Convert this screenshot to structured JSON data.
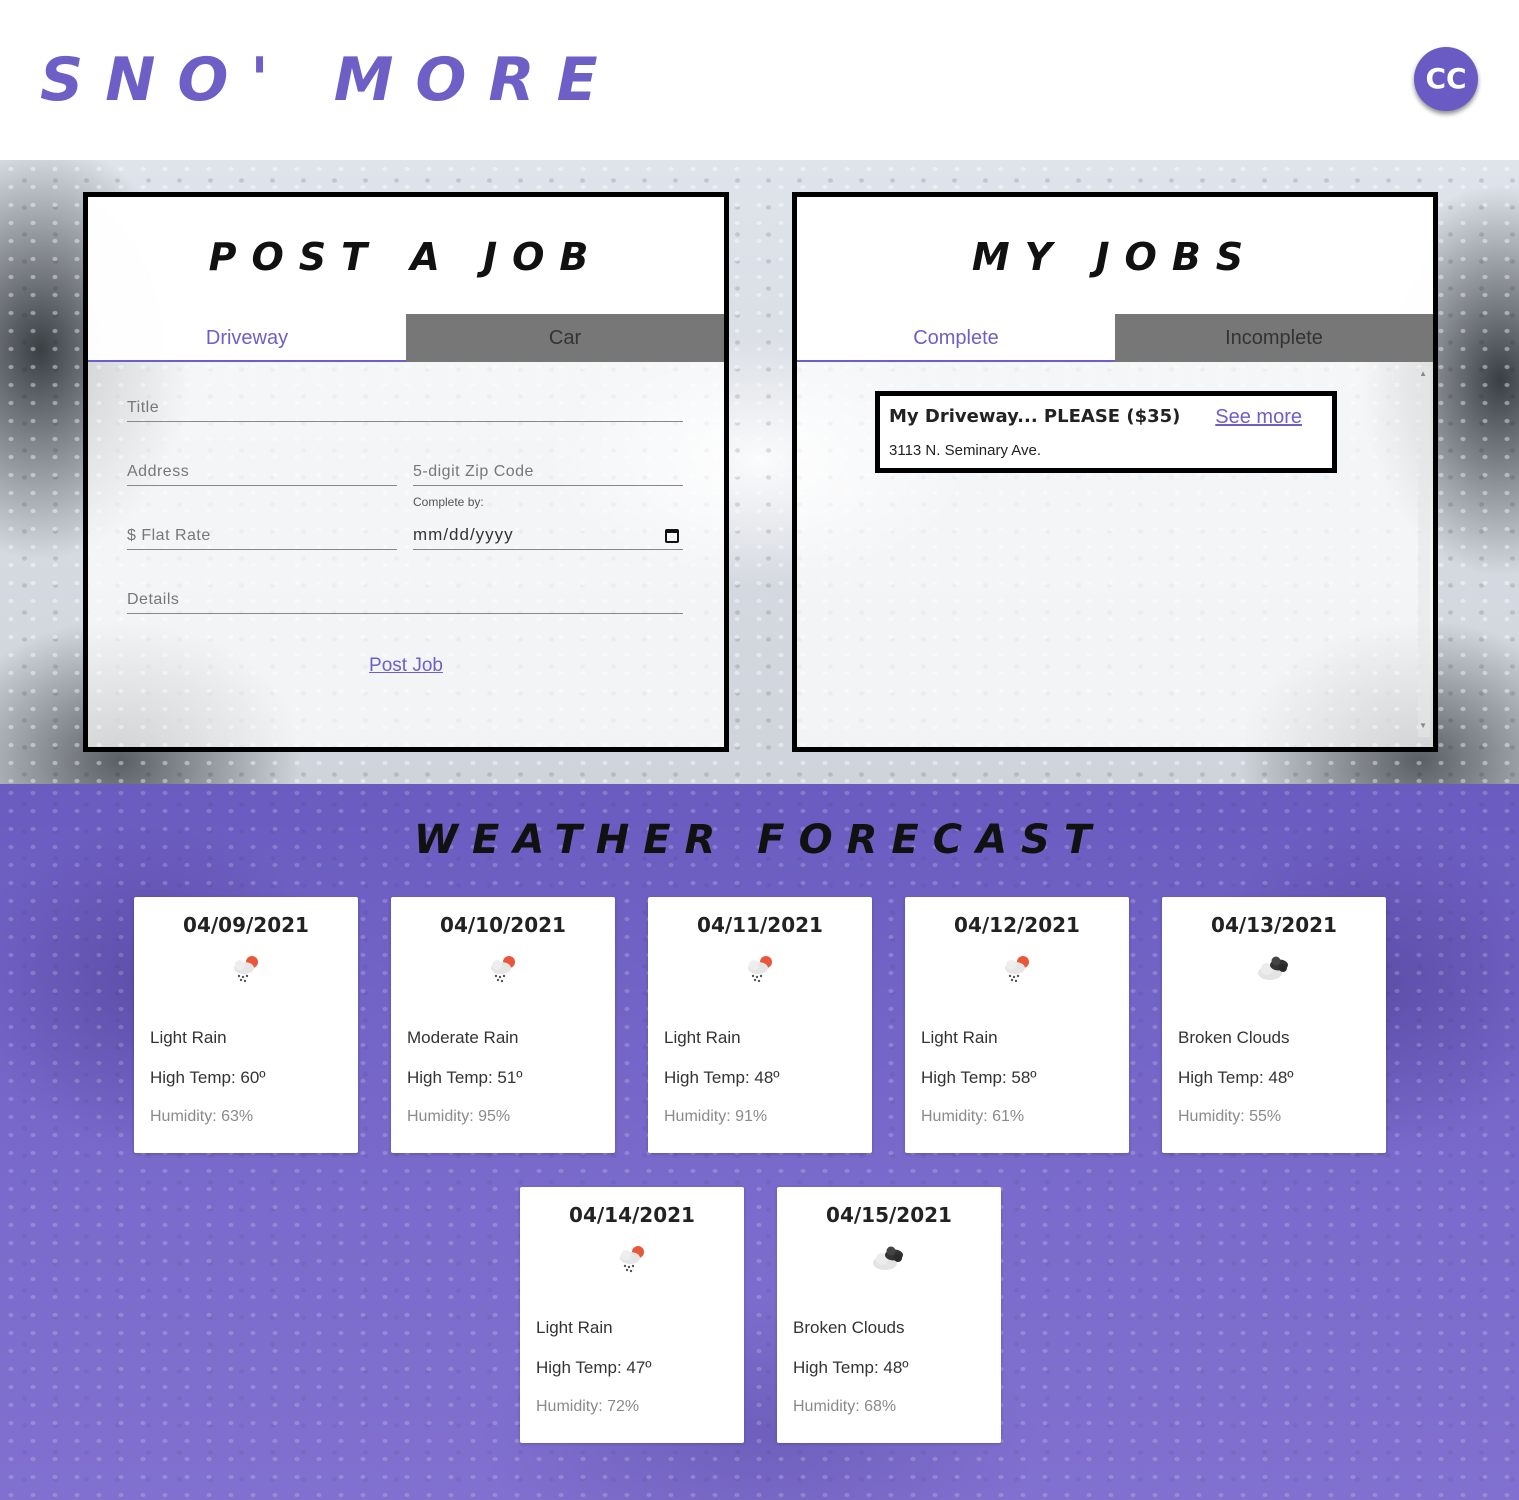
{
  "header": {
    "logo": "SNO' MORE",
    "avatar_initials": "CC"
  },
  "colors": {
    "accent": "#6e5fc6",
    "weather_bg": "#7566c8",
    "panel_border": "#000000"
  },
  "post_job": {
    "title": "POST A JOB",
    "tabs": [
      {
        "label": "Driveway",
        "active": true
      },
      {
        "label": "Car",
        "active": false
      }
    ],
    "fields": {
      "title_placeholder": "Title",
      "address_placeholder": "Address",
      "zip_placeholder": "5-digit Zip Code",
      "rate_placeholder": "$ Flat Rate",
      "complete_by_label": "Complete by:",
      "complete_by_value": "mm/dd/yyyy",
      "details_placeholder": "Details"
    },
    "submit_label": "Post Job"
  },
  "my_jobs": {
    "title": "MY JOBS",
    "tabs": [
      {
        "label": "Complete",
        "active": true
      },
      {
        "label": "Incomplete",
        "active": false
      }
    ],
    "jobs": [
      {
        "title": "My Driveway... PLEASE ($35)",
        "link": "See more",
        "address": "3113 N. Seminary Ave."
      }
    ]
  },
  "weather": {
    "title": "WEATHER FORECAST",
    "days": [
      {
        "date": "04/09/2021",
        "icon": "light-rain-icon",
        "desc": "Light Rain",
        "temp": "High Temp: 60º",
        "humidity": "Humidity: 63%"
      },
      {
        "date": "04/10/2021",
        "icon": "light-rain-icon",
        "desc": "Moderate Rain",
        "temp": "High Temp: 51º",
        "humidity": "Humidity: 95%"
      },
      {
        "date": "04/11/2021",
        "icon": "light-rain-icon",
        "desc": "Light Rain",
        "temp": "High Temp: 48º",
        "humidity": "Humidity: 91%"
      },
      {
        "date": "04/12/2021",
        "icon": "light-rain-icon",
        "desc": "Light Rain",
        "temp": "High Temp: 58º",
        "humidity": "Humidity: 61%"
      },
      {
        "date": "04/13/2021",
        "icon": "broken-clouds-icon",
        "desc": "Broken Clouds",
        "temp": "High Temp: 48º",
        "humidity": "Humidity: 55%"
      },
      {
        "date": "04/14/2021",
        "icon": "light-rain-icon",
        "desc": "Light Rain",
        "temp": "High Temp: 47º",
        "humidity": "Humidity: 72%"
      },
      {
        "date": "04/15/2021",
        "icon": "broken-clouds-icon",
        "desc": "Broken Clouds",
        "temp": "High Temp: 48º",
        "humidity": "Humidity: 68%"
      }
    ]
  }
}
